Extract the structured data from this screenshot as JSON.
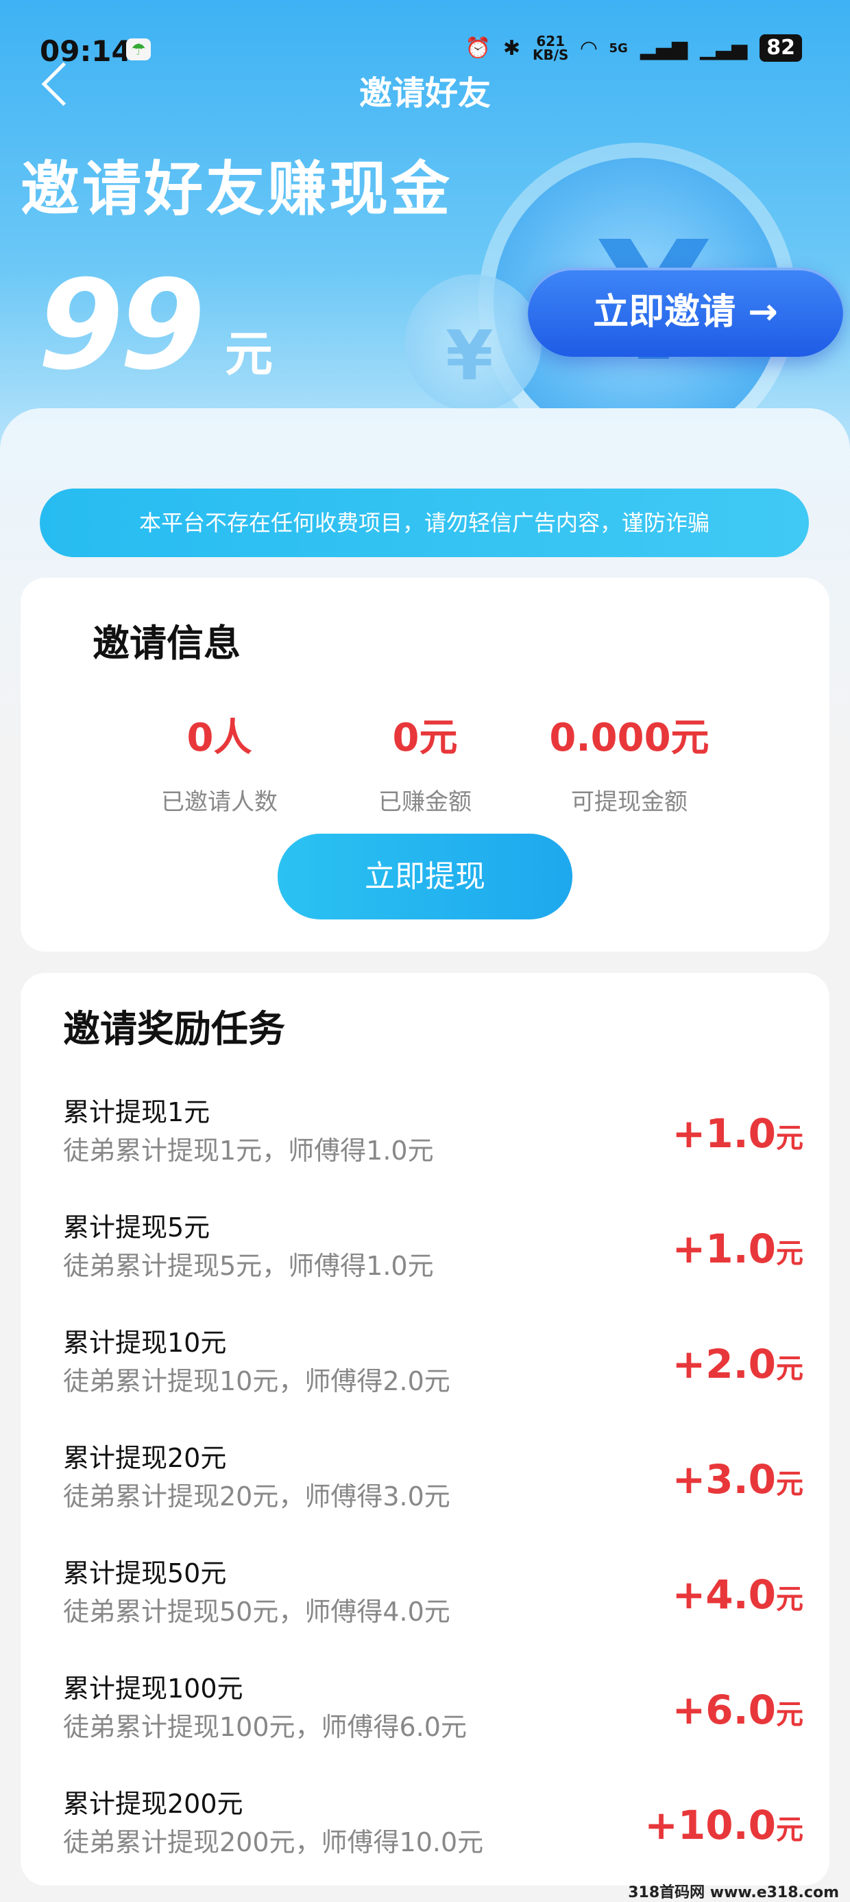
{
  "status_bar": {
    "time": "09:14",
    "net_speed": "621",
    "net_unit": "KB/S",
    "signal": "5G",
    "battery": "82"
  },
  "header": {
    "title": "邀请好友"
  },
  "hero": {
    "headline": "邀请好友赚现金",
    "amount": "99",
    "unit": "元",
    "invite_button": "立即邀请 →"
  },
  "notice": "本平台不存在任何收费项目，请勿轻信广告内容，谨防诈骗",
  "invite_info": {
    "title": "邀请信息",
    "stats": [
      {
        "value": "0人",
        "label": "已邀请人数"
      },
      {
        "value": "0元",
        "label": "已赚金额"
      },
      {
        "value": "0.000元",
        "label": "可提现金额"
      }
    ],
    "withdraw_button": "立即提现"
  },
  "tasks": {
    "title": "邀请奖励任务",
    "items": [
      {
        "name": "累计提现1元",
        "desc": "徒弟累计提现1元，师傅得1.0元",
        "reward": "+1.0",
        "unit": "元"
      },
      {
        "name": "累计提现5元",
        "desc": "徒弟累计提现5元，师傅得1.0元",
        "reward": "+1.0",
        "unit": "元"
      },
      {
        "name": "累计提现10元",
        "desc": "徒弟累计提现10元，师傅得2.0元",
        "reward": "+2.0",
        "unit": "元"
      },
      {
        "name": "累计提现20元",
        "desc": "徒弟累计提现20元，师傅得3.0元",
        "reward": "+3.0",
        "unit": "元"
      },
      {
        "name": "累计提现50元",
        "desc": "徒弟累计提现50元，师傅得4.0元",
        "reward": "+4.0",
        "unit": "元"
      },
      {
        "name": "累计提现100元",
        "desc": "徒弟累计提现100元，师傅得6.0元",
        "reward": "+6.0",
        "unit": "元"
      },
      {
        "name": "累计提现200元",
        "desc": "徒弟累计提现200元，师傅得10.0元",
        "reward": "+10.0",
        "unit": "元"
      }
    ]
  },
  "watermark": "318首码网 www.e318.com"
}
